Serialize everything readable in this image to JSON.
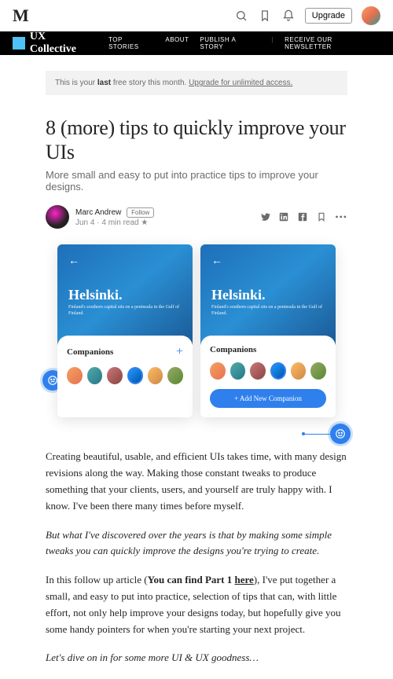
{
  "topbar": {
    "upgrade_label": "Upgrade"
  },
  "publication": {
    "name": "UX Collective",
    "nav": {
      "top_stories": "TOP STORIES",
      "about": "ABOUT",
      "publish": "PUBLISH A STORY",
      "newsletter": "RECEIVE OUR NEWSLETTER"
    }
  },
  "banner": {
    "prefix": "This is your ",
    "bold": "last",
    "mid": " free story this month. ",
    "link": "Upgrade for unlimited access."
  },
  "article": {
    "title": "8 (more) tips to quickly improve your UIs",
    "subtitle": "More small and easy to put into practice tips to improve your designs.",
    "author": "Marc Andrew",
    "follow_label": "Follow",
    "meta": "Jun 4 · 4 min read  ★"
  },
  "hero": {
    "city": "Helsinki.",
    "city_sub": "Finland's southern capital sits on a peninsula in the Gulf of Finland.",
    "section": "Companions",
    "add_label": "+ Add New Companion"
  },
  "body": {
    "p1": "Creating beautiful, usable, and efficient UIs takes time, with many design revisions along the way. Making those constant tweaks to produce something that your clients, users, and yourself are truly happy with. I know. I've been there many times before myself.",
    "p2": "But what I've discovered over the years is that by making some simple tweaks you can quickly improve the designs you're trying to create.",
    "p3a": "In this follow up article (",
    "p3b": "You can find Part 1 ",
    "p3c": "here",
    "p3d": "), I've put together a small, and easy to put into practice, selection of tips that can, with little effort, not only help improve your designs today, but hopefully give you some handy pointers for when you're starting your next project.",
    "p4": "Let's dive on in for some more UI & UX goodness…"
  }
}
